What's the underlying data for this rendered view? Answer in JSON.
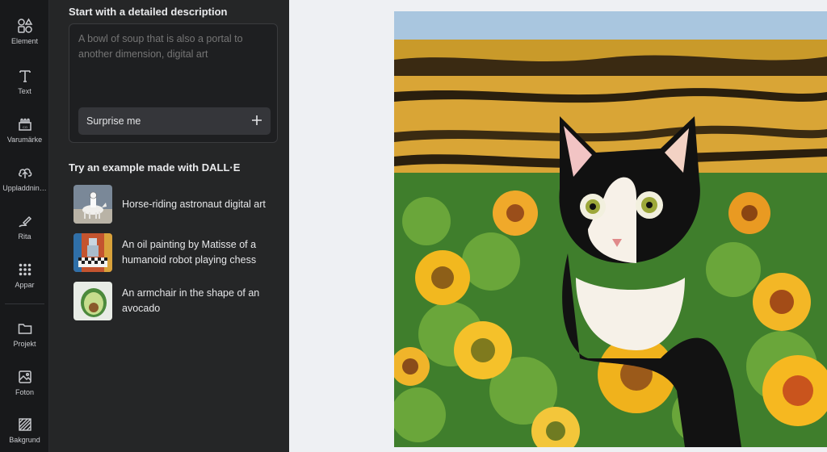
{
  "rail": {
    "items": [
      {
        "label": "Element",
        "icon": "elements-icon"
      },
      {
        "label": "Text",
        "icon": "text-icon"
      },
      {
        "label": "Varumärke",
        "icon": "brand-icon"
      },
      {
        "label": "Uppladdnin…",
        "icon": "upload-icon"
      },
      {
        "label": "Rita",
        "icon": "draw-icon"
      },
      {
        "label": "Appar",
        "icon": "apps-icon"
      },
      {
        "label": "Projekt",
        "icon": "folder-icon"
      },
      {
        "label": "Foton",
        "icon": "photos-icon"
      },
      {
        "label": "Bakgrund",
        "icon": "background-icon"
      }
    ]
  },
  "panel": {
    "heading": "Start with a detailed description",
    "prompt_placeholder": "A bowl of soup that is also a portal to another dimension, digital art",
    "surprise_label": "Surprise me",
    "surprise_icon": "plus-icon",
    "examples_heading": "Try an example made with DALL·E",
    "examples": [
      {
        "text": "Horse-riding astronaut digital art",
        "thumb": "astronaut-thumbnail"
      },
      {
        "text": "An oil painting by Matisse of a humanoid robot playing chess",
        "thumb": "robot-chess-thumbnail"
      },
      {
        "text": "An armchair in the shape of an avocado",
        "thumb": "avocado-chair-thumbnail"
      }
    ]
  },
  "collapse_icon": "chevron-left-icon",
  "canvas": {
    "artwork": "cat-in-sunflower-field-painting"
  },
  "colors": {
    "rail_bg": "#18191b",
    "panel_bg": "#252627",
    "canvas_bg": "#eef0f3"
  }
}
